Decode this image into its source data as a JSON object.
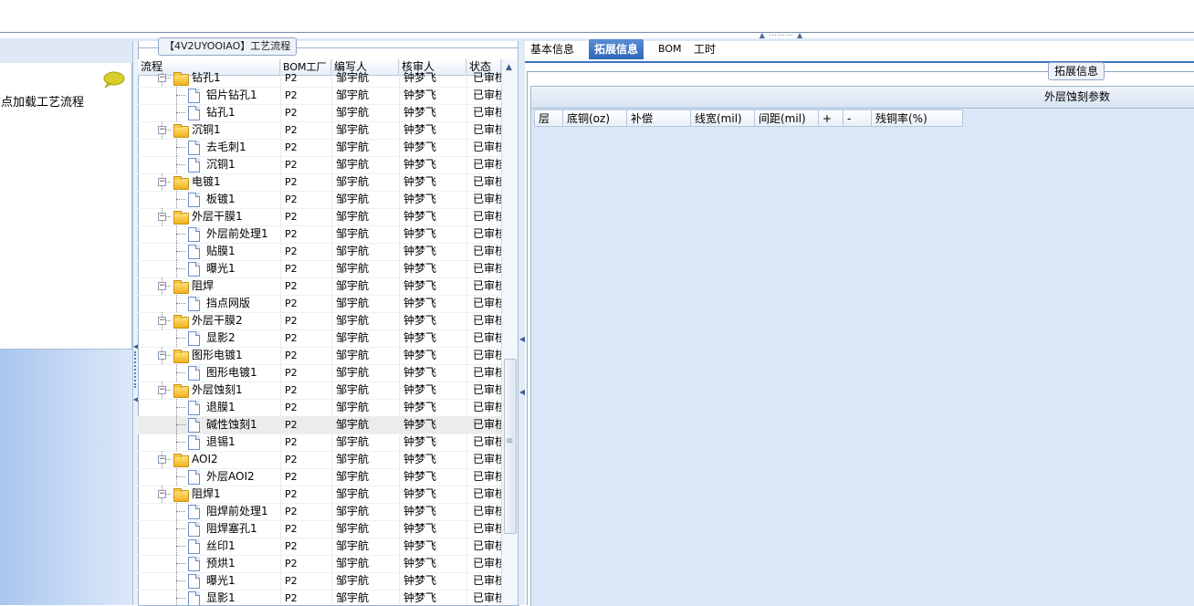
{
  "left_panel": {
    "title": "节点加载工艺流程"
  },
  "middle_panel": {
    "caption": "【4V2UYOOIAO】工艺流程",
    "columns": [
      "流程",
      "BOM工厂",
      "编写人",
      "核审人",
      "状态"
    ],
    "rows": [
      {
        "name": "钻孔1",
        "bom": "P2",
        "writer": "邹宇航",
        "reviewer": "钟梦飞",
        "status": "已审核"
      },
      {
        "name": "铝片钻孔1",
        "bom": "P2",
        "writer": "邹宇航",
        "reviewer": "钟梦飞",
        "status": "已审核"
      },
      {
        "name": "钻孔1",
        "bom": "P2",
        "writer": "邹宇航",
        "reviewer": "钟梦飞",
        "status": "已审核"
      },
      {
        "name": "沉铜1",
        "bom": "P2",
        "writer": "邹宇航",
        "reviewer": "钟梦飞",
        "status": "已审核"
      },
      {
        "name": "去毛刺1",
        "bom": "P2",
        "writer": "邹宇航",
        "reviewer": "钟梦飞",
        "status": "已审核"
      },
      {
        "name": "沉铜1",
        "bom": "P2",
        "writer": "邹宇航",
        "reviewer": "钟梦飞",
        "status": "已审核"
      },
      {
        "name": "电镀1",
        "bom": "P2",
        "writer": "邹宇航",
        "reviewer": "钟梦飞",
        "status": "已审核"
      },
      {
        "name": "板镀1",
        "bom": "P2",
        "writer": "邹宇航",
        "reviewer": "钟梦飞",
        "status": "已审核"
      },
      {
        "name": "外层干膜1",
        "bom": "P2",
        "writer": "邹宇航",
        "reviewer": "钟梦飞",
        "status": "已审核"
      },
      {
        "name": "外层前处理1",
        "bom": "P2",
        "writer": "邹宇航",
        "reviewer": "钟梦飞",
        "status": "已审核"
      },
      {
        "name": "贴膜1",
        "bom": "P2",
        "writer": "邹宇航",
        "reviewer": "钟梦飞",
        "status": "已审核"
      },
      {
        "name": "曝光1",
        "bom": "P2",
        "writer": "邹宇航",
        "reviewer": "钟梦飞",
        "status": "已审核"
      },
      {
        "name": "阻焊",
        "bom": "P2",
        "writer": "邹宇航",
        "reviewer": "钟梦飞",
        "status": "已审核"
      },
      {
        "name": "挡点网版",
        "bom": "P2",
        "writer": "邹宇航",
        "reviewer": "钟梦飞",
        "status": "已审核"
      },
      {
        "name": "外层干膜2",
        "bom": "P2",
        "writer": "邹宇航",
        "reviewer": "钟梦飞",
        "status": "已审核"
      },
      {
        "name": "显影2",
        "bom": "P2",
        "writer": "邹宇航",
        "reviewer": "钟梦飞",
        "status": "已审核"
      },
      {
        "name": "图形电镀1",
        "bom": "P2",
        "writer": "邹宇航",
        "reviewer": "钟梦飞",
        "status": "已审核"
      },
      {
        "name": "图形电镀1",
        "bom": "P2",
        "writer": "邹宇航",
        "reviewer": "钟梦飞",
        "status": "已审核"
      },
      {
        "name": "外层蚀刻1",
        "bom": "P2",
        "writer": "邹宇航",
        "reviewer": "钟梦飞",
        "status": "已审核"
      },
      {
        "name": "退膜1",
        "bom": "P2",
        "writer": "邹宇航",
        "reviewer": "钟梦飞",
        "status": "已审核"
      },
      {
        "name": "碱性蚀刻1",
        "bom": "P2",
        "writer": "邹宇航",
        "reviewer": "钟梦飞",
        "status": "已审核"
      },
      {
        "name": "退锡1",
        "bom": "P2",
        "writer": "邹宇航",
        "reviewer": "钟梦飞",
        "status": "已审核"
      },
      {
        "name": "AOI2",
        "bom": "P2",
        "writer": "邹宇航",
        "reviewer": "钟梦飞",
        "status": "已审核"
      },
      {
        "name": "外层AOI2",
        "bom": "P2",
        "writer": "邹宇航",
        "reviewer": "钟梦飞",
        "status": "已审核"
      },
      {
        "name": "阻焊1",
        "bom": "P2",
        "writer": "邹宇航",
        "reviewer": "钟梦飞",
        "status": "已审核"
      },
      {
        "name": "阻焊前处理1",
        "bom": "P2",
        "writer": "邹宇航",
        "reviewer": "钟梦飞",
        "status": "已审核"
      },
      {
        "name": "阻焊塞孔1",
        "bom": "P2",
        "writer": "邹宇航",
        "reviewer": "钟梦飞",
        "status": "已审核"
      },
      {
        "name": "丝印1",
        "bom": "P2",
        "writer": "邹宇航",
        "reviewer": "钟梦飞",
        "status": "已审核"
      },
      {
        "name": "预烘1",
        "bom": "P2",
        "writer": "邹宇航",
        "reviewer": "钟梦飞",
        "status": "已审核"
      },
      {
        "name": "曝光1",
        "bom": "P2",
        "writer": "邹宇航",
        "reviewer": "钟梦飞",
        "status": "已审核"
      },
      {
        "name": "显影1",
        "bom": "P2",
        "writer": "邹宇航",
        "reviewer": "钟梦飞",
        "status": "已审核"
      }
    ]
  },
  "right_panel": {
    "tabs": [
      "基本信息",
      "拓展信息",
      "BOM",
      "工时"
    ],
    "active_tab": "拓展信息",
    "fieldset_caption": "拓展信息",
    "section_title": "外层蚀刻参数",
    "param_columns": [
      "层",
      "底铜(oz)",
      "补偿",
      "线宽(mil)",
      "间距(mil)",
      "+",
      "-",
      "残铜率(%)"
    ]
  },
  "colors": {
    "tab_active": "#3f72be",
    "panel_bg": "#dae7f8",
    "folder": "#f0b21c"
  }
}
